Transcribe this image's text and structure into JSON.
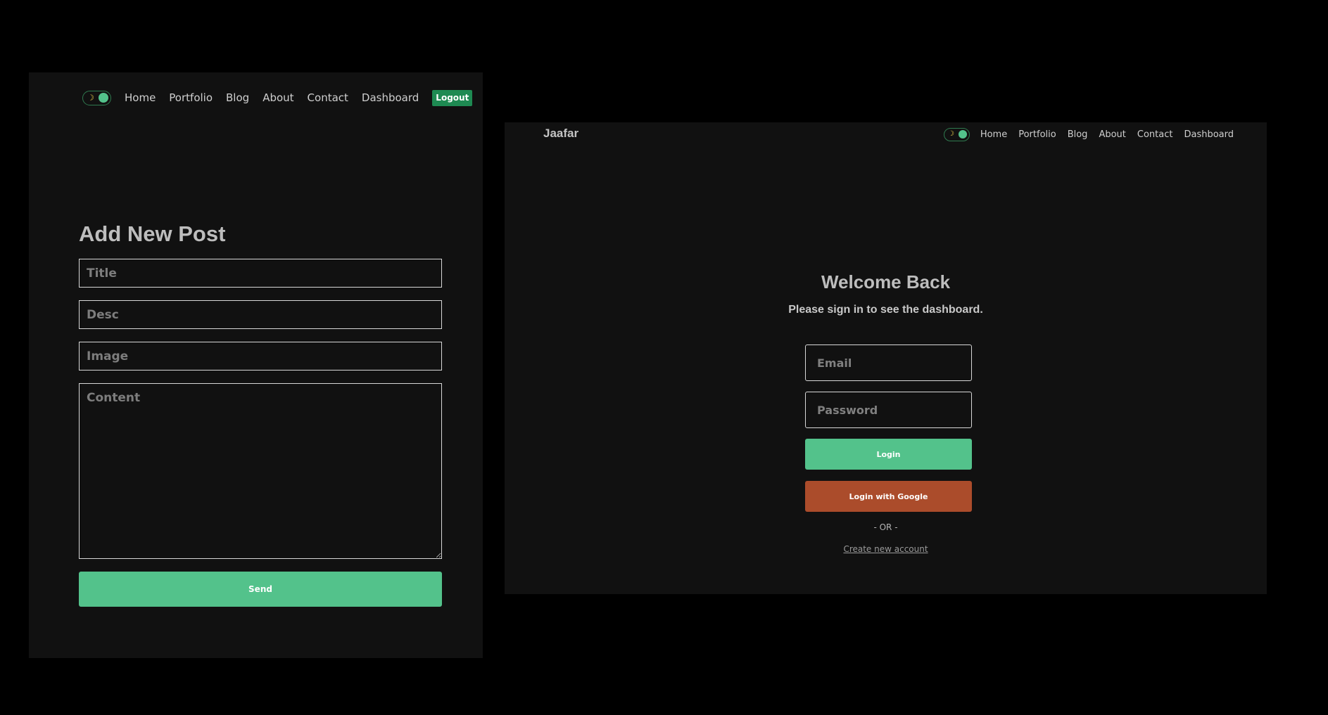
{
  "post_form": {
    "nav": {
      "toggle_icon": "moon-icon",
      "links": [
        "Home",
        "Portfolio",
        "Blog",
        "About",
        "Contact",
        "Dashboard"
      ],
      "logout_label": "Logout"
    },
    "title": "Add New Post",
    "fields": {
      "title_placeholder": "Title",
      "desc_placeholder": "Desc",
      "image_placeholder": "Image",
      "content_placeholder": "Content"
    },
    "send_label": "Send"
  },
  "login": {
    "brand": "Jaafar",
    "nav": {
      "toggle_icon": "moon-icon",
      "links": [
        "Home",
        "Portfolio",
        "Blog",
        "About",
        "Contact",
        "Dashboard"
      ]
    },
    "title": "Welcome Back",
    "subtitle": "Please sign in to see the dashboard.",
    "email_placeholder": "Email",
    "password_placeholder": "Password",
    "login_label": "Login",
    "google_label": "Login with Google",
    "or_text": "- OR -",
    "create_account_label": "Create new account"
  },
  "colors": {
    "page_background": "#000000",
    "panel_background": "#111111",
    "accent_green": "#53c28b",
    "logout_green": "#1e8a52",
    "google_orange": "#ab4c2b",
    "text": "#bbbbbb"
  }
}
